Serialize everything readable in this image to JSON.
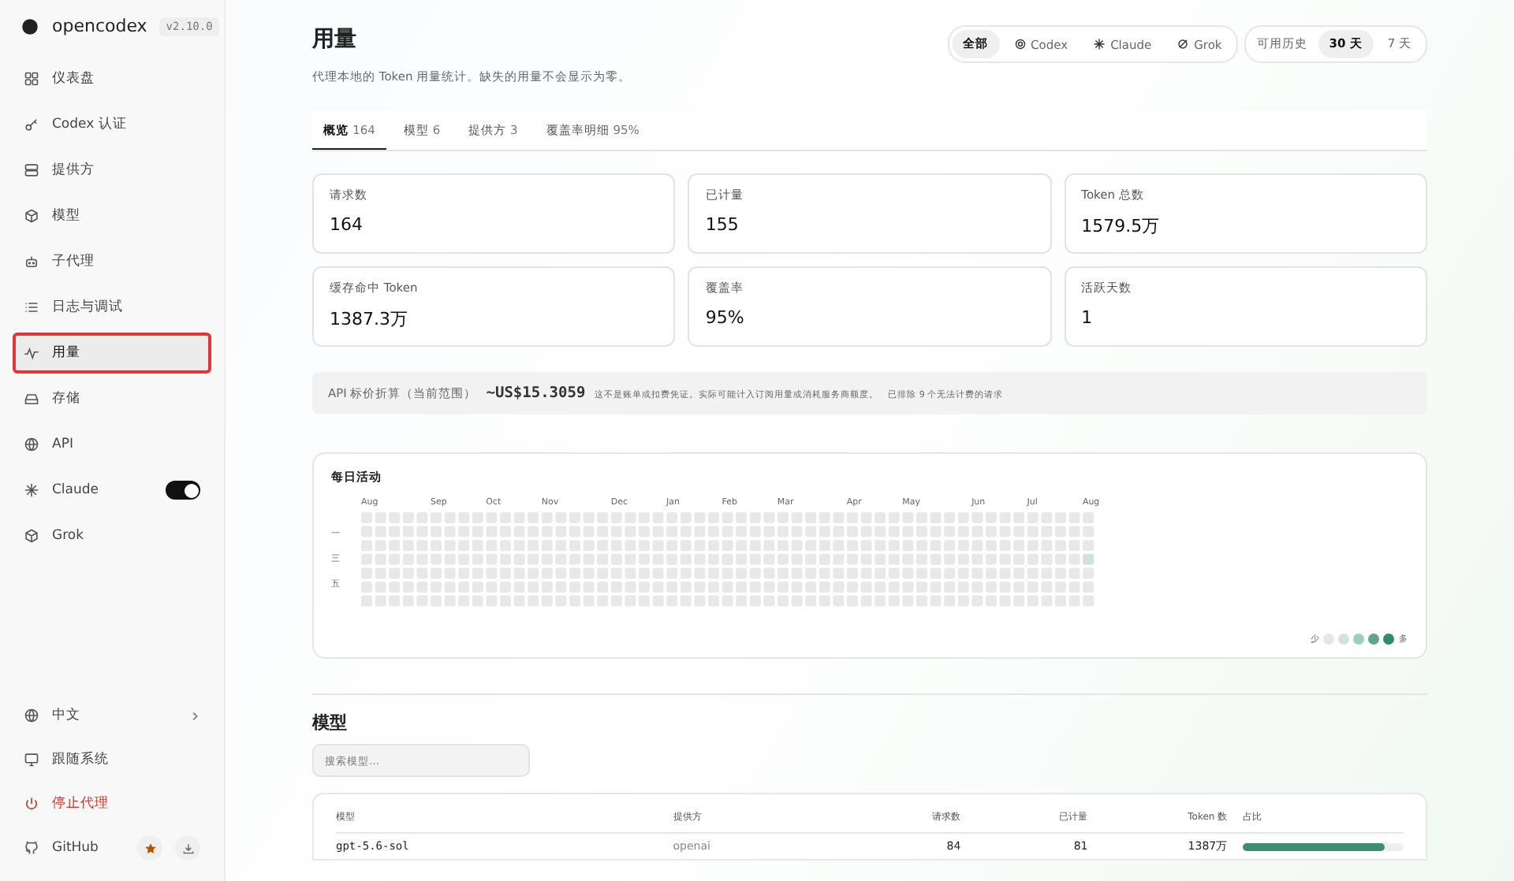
{
  "brand": {
    "name": "opencodex",
    "version": "v2.10.0"
  },
  "nav": [
    {
      "label": "仪表盘",
      "selected": false
    },
    {
      "label": "Codex 认证",
      "selected": false
    },
    {
      "label": "提供方",
      "selected": false
    },
    {
      "label": "模型",
      "selected": false
    },
    {
      "label": "子代理",
      "selected": false
    },
    {
      "label": "日志与调试",
      "selected": false
    },
    {
      "label": "用量",
      "selected": true
    },
    {
      "label": "存储",
      "selected": false
    },
    {
      "label": "API",
      "selected": false
    },
    {
      "label": "Claude",
      "selected": false,
      "toggle": {
        "on": true
      }
    },
    {
      "label": "Grok",
      "selected": false
    }
  ],
  "footer": {
    "language": "中文",
    "theme": "跟随系统",
    "stop": "停止代理",
    "github": "GitHub"
  },
  "page": {
    "title": "用量",
    "subtitle": "代理本地的 Token 用量统计。缺失的用量不会显示为零。"
  },
  "filters": [
    {
      "label": "全部",
      "selected": true
    },
    {
      "label": "Codex",
      "selected": false
    },
    {
      "label": "Claude",
      "selected": false
    },
    {
      "label": "Grok",
      "selected": false
    }
  ],
  "range": {
    "label": "可用历史",
    "options": [
      {
        "label": "30 天",
        "selected": true
      },
      {
        "label": "7 天",
        "selected": false
      }
    ]
  },
  "tabs": [
    {
      "label": "概览",
      "count": "164",
      "selected": true
    },
    {
      "label": "模型",
      "count": "6",
      "selected": false
    },
    {
      "label": "提供方",
      "count": "3",
      "selected": false
    },
    {
      "label": "覆盖率明细",
      "count": "95%",
      "selected": false
    }
  ],
  "stats": [
    {
      "label": "请求数",
      "value": "164"
    },
    {
      "label": "已计量",
      "value": "155"
    },
    {
      "label": "Token 总数",
      "value": "1579.5万"
    },
    {
      "label": "缓存命中 Token",
      "value": "1387.3万"
    },
    {
      "label": "覆盖率",
      "value": "95%"
    },
    {
      "label": "活跃天数",
      "value": "1"
    }
  ],
  "cost": {
    "label": "API 标价折算（当前范围）",
    "value": "~US$15.3059",
    "note": "这不是账单或扣费凭证。实际可能计入订阅用量或消耗服务商额度。",
    "excluded": "已排除 9 个无法计费的请求"
  },
  "activity": {
    "title": "每日活动",
    "months": [
      "Aug",
      "Sep",
      "Oct",
      "Nov",
      "Dec",
      "Jan",
      "Feb",
      "Mar",
      "Apr",
      "May",
      "Jun",
      "Jul",
      "Aug"
    ],
    "days": [
      "一",
      "三",
      "五"
    ],
    "legend_low": "少",
    "legend_high": "多"
  },
  "models": {
    "title": "模型",
    "search_placeholder": "搜索模型…",
    "columns": [
      "模型",
      "提供方",
      "请求数",
      "已计量",
      "Token 数",
      "占比"
    ],
    "rows": [
      {
        "model": "gpt-5.6-sol",
        "provider": "openai",
        "requests": "84",
        "metered": "81",
        "tokens": "1387万",
        "level": 0.88
      }
    ]
  }
}
